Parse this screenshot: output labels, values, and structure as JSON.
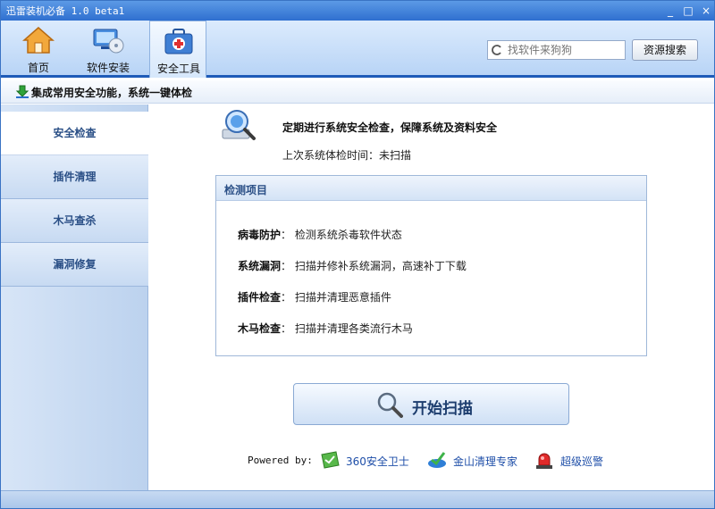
{
  "window": {
    "title": "迅雷装机必备 1.0 beta1",
    "controls": [
      "_",
      "□",
      "×"
    ]
  },
  "toolbar": {
    "tools": [
      {
        "label": "首页",
        "icon": "home-icon"
      },
      {
        "label": "软件安装",
        "icon": "monitor-disc-icon"
      },
      {
        "label": "安全工具",
        "icon": "first-aid-kit-icon",
        "active": true
      }
    ],
    "search": {
      "placeholder": "找软件来狗狗",
      "button_label": "资源搜索"
    }
  },
  "subheader": {
    "text": "集成常用安全功能，系统一键体检"
  },
  "sidebar": {
    "items": [
      {
        "label": "安全检查",
        "active": true
      },
      {
        "label": "插件清理"
      },
      {
        "label": "木马查杀"
      },
      {
        "label": "漏洞修复"
      }
    ]
  },
  "main": {
    "title": "定期进行系统安全检查，保障系统及资料安全",
    "last_scan_label": "上次系统体检时间：",
    "last_scan_value": "未扫描",
    "detect": {
      "title": "检测项目",
      "rows": [
        {
          "label": "病毒防护",
          "desc": "检测系统杀毒软件状态"
        },
        {
          "label": "系统漏洞",
          "desc": "扫描并修补系统漏洞，高速补丁下载"
        },
        {
          "label": "插件检查",
          "desc": "扫描并清理恶意插件"
        },
        {
          "label": "木马检查",
          "desc": "扫描并清理各类流行木马"
        }
      ]
    },
    "start_button": "开始扫描",
    "powered_by": "Powered by:",
    "partners": [
      {
        "name": "360安全卫士",
        "icon": "360-shield-icon"
      },
      {
        "name": "金山清理专家",
        "icon": "kingsoft-icon"
      },
      {
        "name": "超级巡警",
        "icon": "alarm-light-icon"
      }
    ]
  },
  "colors": {
    "accent": "#1e5bb8",
    "sidebar_text": "#2a4f86",
    "link": "#1e4ea8"
  }
}
